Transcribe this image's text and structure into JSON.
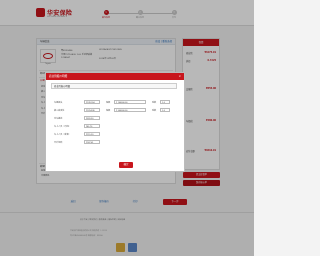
{
  "header": {
    "brand": "华安保险",
    "brand_en": "SINOSAFE INSURANCE",
    "steps": [
      {
        "num": "1",
        "label": "填写信息"
      },
      {
        "num": "2",
        "label": "确认信息"
      },
      {
        "num": "3",
        "label": "支付"
      }
    ]
  },
  "vehicle": {
    "section": "车辆信息",
    "edit_links": "修改 | 重新选择",
    "plate": "粤B123456",
    "model": "丰田TV7164GL 1.6L 手动舒适版",
    "vin": "LFV1A24G7C3012345",
    "engine": "1234567",
    "register_date": "2014年12月03日",
    "brand_label": "Toyota"
  },
  "policy": {
    "section": "商业险",
    "dates": "2015年12月03日 零时起 至 2016年12月03日 24时止",
    "items": [
      "机动车损失保险",
      "第三者责任保险",
      "全车盗抢险",
      "车上人员（司机）",
      "车上人员（乘客）",
      "不计免赔"
    ],
    "insurance_label": "交强险",
    "insurance_sub": "2015年12月03日"
  },
  "owner": {
    "section": "被保险人",
    "items": [
      "投保人",
      "中国居民",
      "证件号码"
    ]
  },
  "right": {
    "title": "保费",
    "rows": [
      {
        "label": "商业险",
        "value": "¥3275.91"
      },
      {
        "label": "折扣",
        "value": "0.7225"
      },
      {
        "label": "交强险",
        "value": "¥855.00"
      },
      {
        "label": "车船税",
        "value": "¥480.00"
      },
      {
        "label": "应付总额",
        "value": "¥4610.91"
      }
    ],
    "btn1": "提交投保单",
    "btn2": "保存报价单"
  },
  "modal": {
    "title": "商业险报价明细",
    "close": "×",
    "subtitle": "商业险报价明细",
    "fields": [
      {
        "label": "车辆损失",
        "value": "¥1352.54"
      },
      {
        "label": "第三者责任",
        "value": "¥1254.36"
      },
      {
        "label": "全车盗抢",
        "value": "¥320.50"
      },
      {
        "label": "车上人员（司机）",
        "value": "¥45.70"
      },
      {
        "label": "车上人员（乘客）",
        "value": "¥115.20"
      },
      {
        "label": "不计免赔",
        "value": "¥187.61"
      }
    ],
    "right_fields": [
      {
        "label": "保额",
        "value": "¥ 100000.00"
      },
      {
        "label": "保额",
        "value": "¥ 500000.00"
      }
    ],
    "small_fields": [
      {
        "label": "系数",
        "value": "1.0"
      },
      {
        "label": "系数",
        "value": "1.0"
      }
    ],
    "ok": "确定"
  },
  "bottom": {
    "back": "返回",
    "save": "保存报价",
    "print": "打印",
    "next": "下一步"
  },
  "footer": {
    "links": "关于华安 | 联系我们 | 服务条款 | 隐私声明 | 网站地图",
    "line1": "华安财产保险股份有限公司 版权所有 © 2015",
    "line2": "粤ICP备05000000号 客服电话：95556"
  }
}
